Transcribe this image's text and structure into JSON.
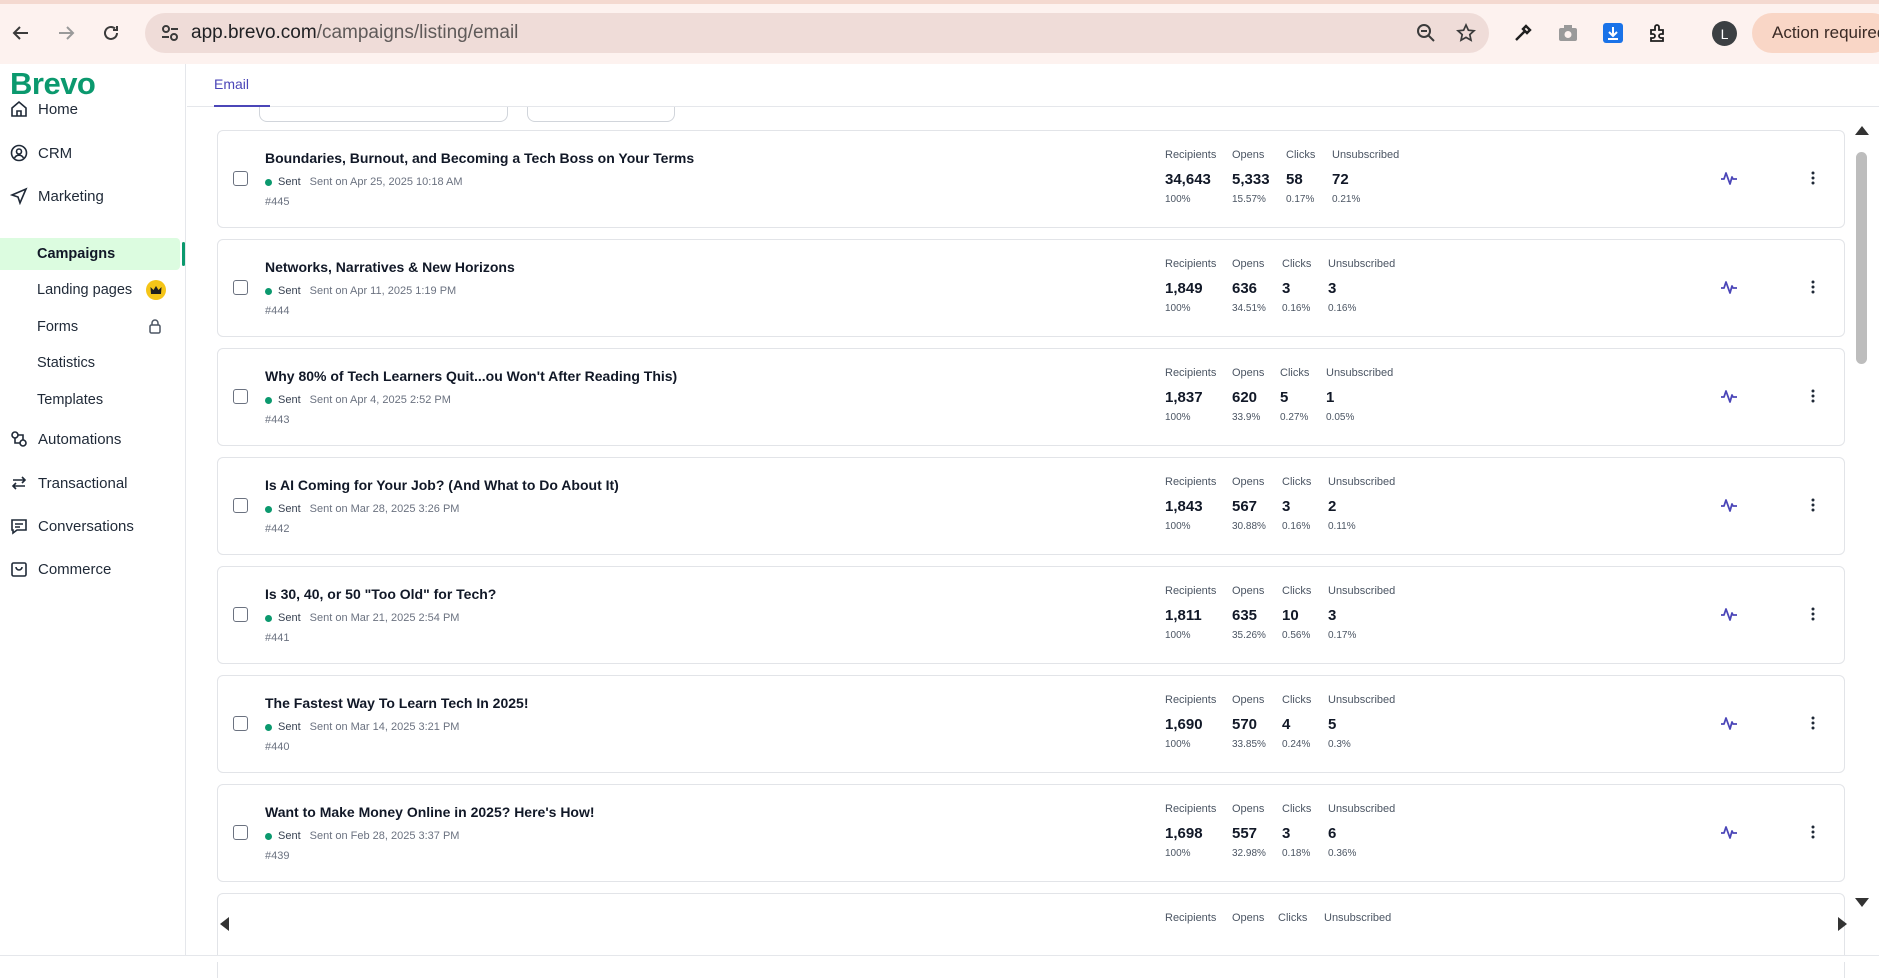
{
  "browser": {
    "url_host": "app.brevo.com",
    "url_path": "/campaigns/listing/email",
    "profile_initial": "L",
    "action_required": "Action required"
  },
  "sidebar": {
    "logo": "Brevo",
    "items": [
      {
        "label": "Home",
        "icon": "home-icon"
      },
      {
        "label": "CRM",
        "icon": "contacts-icon"
      },
      {
        "label": "Marketing",
        "icon": "send-icon"
      }
    ],
    "marketing_sub": [
      {
        "label": "Campaigns",
        "active": true
      },
      {
        "label": "Landing pages"
      },
      {
        "label": "Forms"
      },
      {
        "label": "Statistics"
      },
      {
        "label": "Templates"
      }
    ],
    "items_bottom": [
      {
        "label": "Automations",
        "icon": "automation-icon"
      },
      {
        "label": "Transactional",
        "icon": "transactional-icon"
      },
      {
        "label": "Conversations",
        "icon": "chat-icon"
      },
      {
        "label": "Commerce",
        "icon": "bag-icon"
      }
    ]
  },
  "tabs": {
    "email": "Email"
  },
  "stat_labels": {
    "recipients": "Recipients",
    "opens": "Opens",
    "clicks": "Clicks",
    "unsubscribed": "Unsubscribed"
  },
  "campaigns": [
    {
      "title": "Boundaries, Burnout, and Becoming a Tech Boss on Your Terms",
      "status": "Sent",
      "date": "Sent on Apr 25, 2025 10:18 AM",
      "id": "#445",
      "recipients": "34,643",
      "recipients_pct": "100%",
      "opens": "5,333",
      "opens_pct": "15.57%",
      "clicks": "58",
      "clicks_pct": "0.17%",
      "unsub": "72",
      "unsub_pct": "0.21%"
    },
    {
      "title": "Networks, Narratives & New Horizons",
      "status": "Sent",
      "date": "Sent on Apr 11, 2025 1:19 PM",
      "id": "#444",
      "recipients": "1,849",
      "recipients_pct": "100%",
      "opens": "636",
      "opens_pct": "34.51%",
      "clicks": "3",
      "clicks_pct": "0.16%",
      "unsub": "3",
      "unsub_pct": "0.16%"
    },
    {
      "title": "Why 80% of Tech Learners Quit...ou Won't After Reading This)",
      "status": "Sent",
      "date": "Sent on Apr 4, 2025 2:52 PM",
      "id": "#443",
      "recipients": "1,837",
      "recipients_pct": "100%",
      "opens": "620",
      "opens_pct": "33.9%",
      "clicks": "5",
      "clicks_pct": "0.27%",
      "unsub": "1",
      "unsub_pct": "0.05%"
    },
    {
      "title": "Is AI Coming for Your Job? (And What to Do About It)",
      "status": "Sent",
      "date": "Sent on Mar 28, 2025 3:26 PM",
      "id": "#442",
      "recipients": "1,843",
      "recipients_pct": "100%",
      "opens": "567",
      "opens_pct": "30.88%",
      "clicks": "3",
      "clicks_pct": "0.16%",
      "unsub": "2",
      "unsub_pct": "0.11%"
    },
    {
      "title": "Is 30, 40, or 50 \"Too Old\" for Tech?",
      "status": "Sent",
      "date": "Sent on Mar 21, 2025 2:54 PM",
      "id": "#441",
      "recipients": "1,811",
      "recipients_pct": "100%",
      "opens": "635",
      "opens_pct": "35.26%",
      "clicks": "10",
      "clicks_pct": "0.56%",
      "unsub": "3",
      "unsub_pct": "0.17%"
    },
    {
      "title": "The Fastest Way To Learn Tech In 2025!",
      "status": "Sent",
      "date": "Sent on Mar 14, 2025 3:21 PM",
      "id": "#440",
      "recipients": "1,690",
      "recipients_pct": "100%",
      "opens": "570",
      "opens_pct": "33.85%",
      "clicks": "4",
      "clicks_pct": "0.24%",
      "unsub": "5",
      "unsub_pct": "0.3%"
    },
    {
      "title": "Want to Make Money Online in 2025? Here's How!",
      "status": "Sent",
      "date": "Sent on Feb 28, 2025 3:37 PM",
      "id": "#439",
      "recipients": "1,698",
      "recipients_pct": "100%",
      "opens": "557",
      "opens_pct": "32.98%",
      "clicks": "3",
      "clicks_pct": "0.18%",
      "unsub": "6",
      "unsub_pct": "0.36%"
    }
  ],
  "colors": {
    "brand": "#0b996e",
    "accent": "#4b46b8",
    "active_bg": "#dcfce0"
  }
}
